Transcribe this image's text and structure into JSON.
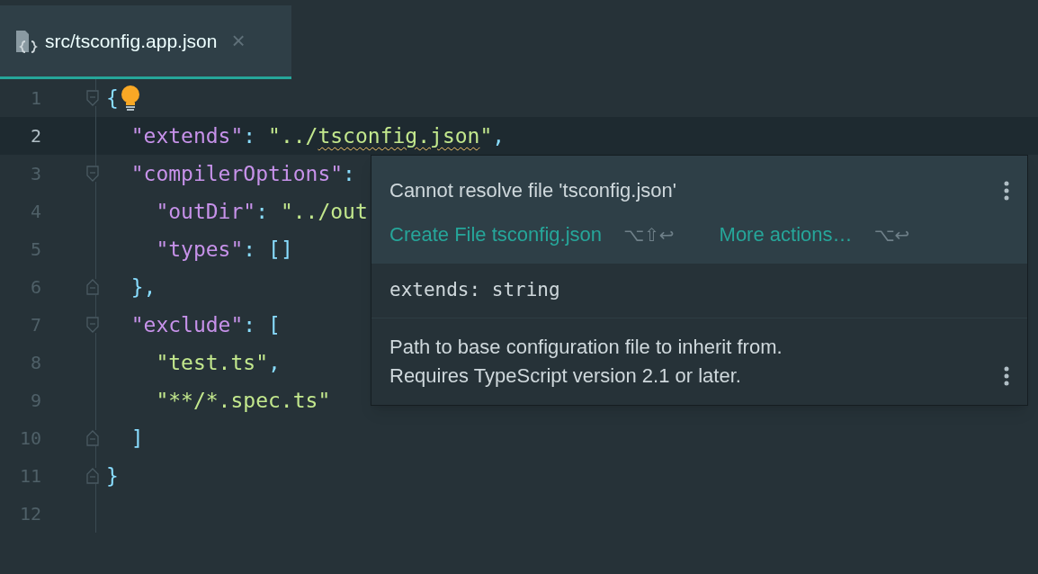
{
  "tabs": [
    {
      "label": "src/tsconfig.app.json",
      "close": "×",
      "selected": true
    }
  ],
  "editor": {
    "lines": [
      {
        "number": "1",
        "fold_start": true,
        "fold_end": false,
        "current": false,
        "lightbulb": true,
        "tokens": [
          {
            "kind": "bracket",
            "text": "{"
          }
        ]
      },
      {
        "number": "2",
        "fold_start": false,
        "fold_end": false,
        "current": true,
        "lightbulb": false,
        "tokens": [
          {
            "kind": "key",
            "text": "  \"extends\""
          },
          {
            "kind": "punct",
            "text": ": "
          },
          {
            "kind": "string",
            "text": "\"../"
          },
          {
            "kind": "string",
            "text": "tsconfig.json",
            "warning": true
          },
          {
            "kind": "string",
            "text": "\""
          },
          {
            "kind": "punct",
            "text": ","
          }
        ]
      },
      {
        "number": "3",
        "fold_start": true,
        "fold_end": false,
        "current": false,
        "lightbulb": false,
        "tokens": [
          {
            "kind": "key",
            "text": "  \"compilerOptions\""
          },
          {
            "kind": "punct",
            "text": ":"
          }
        ]
      },
      {
        "number": "4",
        "fold_start": false,
        "fold_end": false,
        "current": false,
        "lightbulb": false,
        "tokens": [
          {
            "kind": "key",
            "text": "    \"outDir\""
          },
          {
            "kind": "punct",
            "text": ": "
          },
          {
            "kind": "string",
            "text": "\"../out"
          }
        ]
      },
      {
        "number": "5",
        "fold_start": false,
        "fold_end": false,
        "current": false,
        "lightbulb": false,
        "tokens": [
          {
            "kind": "key",
            "text": "    \"types\""
          },
          {
            "kind": "punct",
            "text": ": "
          },
          {
            "kind": "bracket",
            "text": "[]"
          }
        ]
      },
      {
        "number": "6",
        "fold_start": false,
        "fold_end": true,
        "current": false,
        "lightbulb": false,
        "tokens": [
          {
            "kind": "bracket",
            "text": "  }"
          },
          {
            "kind": "punct",
            "text": ","
          }
        ]
      },
      {
        "number": "7",
        "fold_start": true,
        "fold_end": false,
        "current": false,
        "lightbulb": false,
        "tokens": [
          {
            "kind": "key",
            "text": "  \"exclude\""
          },
          {
            "kind": "punct",
            "text": ": "
          },
          {
            "kind": "bracket",
            "text": "["
          }
        ]
      },
      {
        "number": "8",
        "fold_start": false,
        "fold_end": false,
        "current": false,
        "lightbulb": false,
        "tokens": [
          {
            "kind": "string",
            "text": "    \"test.ts\""
          },
          {
            "kind": "punct",
            "text": ","
          }
        ]
      },
      {
        "number": "9",
        "fold_start": false,
        "fold_end": false,
        "current": false,
        "lightbulb": false,
        "tokens": [
          {
            "kind": "string",
            "text": "    \"**/*.spec.ts\""
          }
        ]
      },
      {
        "number": "10",
        "fold_start": false,
        "fold_end": true,
        "current": false,
        "lightbulb": false,
        "tokens": [
          {
            "kind": "bracket",
            "text": "  ]"
          }
        ]
      },
      {
        "number": "11",
        "fold_start": false,
        "fold_end": true,
        "current": false,
        "lightbulb": false,
        "tokens": [
          {
            "kind": "bracket",
            "text": "}"
          }
        ]
      },
      {
        "number": "12",
        "fold_start": false,
        "fold_end": false,
        "current": false,
        "lightbulb": false
      }
    ]
  },
  "popup": {
    "message": "Cannot resolve file 'tsconfig.json'",
    "actions": [
      {
        "label": "Create File tsconfig.json",
        "shortcut": "⌥⇧↩"
      },
      {
        "label": "More actions…",
        "shortcut": "⌥↩"
      }
    ],
    "signature": "extends: string",
    "description": [
      "Path to base configuration file to inherit from.",
      "Requires TypeScript version 2.1 or later."
    ]
  }
}
